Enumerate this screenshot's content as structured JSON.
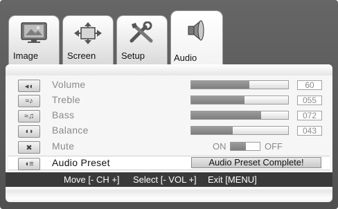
{
  "tabs": [
    {
      "label": "Image",
      "icon": "tv-picture-icon"
    },
    {
      "label": "Screen",
      "icon": "arrows-expand-icon"
    },
    {
      "label": "Setup",
      "icon": "tools-icon"
    },
    {
      "label": "Audio",
      "icon": "speaker-icon",
      "active": true
    }
  ],
  "settings": [
    {
      "label": "Volume",
      "value": "60",
      "level": 0.6
    },
    {
      "label": "Treble",
      "value": "055",
      "level": 0.55
    },
    {
      "label": "Bass",
      "value": "072",
      "level": 0.72
    },
    {
      "label": "Balance",
      "value": "043",
      "level": 0.43
    }
  ],
  "mute": {
    "label": "Mute",
    "on_label": "ON",
    "off_label": "OFF"
  },
  "audio_preset": {
    "label": "Audio Preset",
    "status": "Audio Preset Complete!"
  },
  "hints": {
    "move": "Move [- CH +]",
    "select": "Select [- VOL +]",
    "exit": "Exit [MENU]"
  },
  "colors": {
    "frame": "#5a5a5a",
    "panel": "#f6f6f6",
    "hintbar": "#3a3a3a"
  }
}
